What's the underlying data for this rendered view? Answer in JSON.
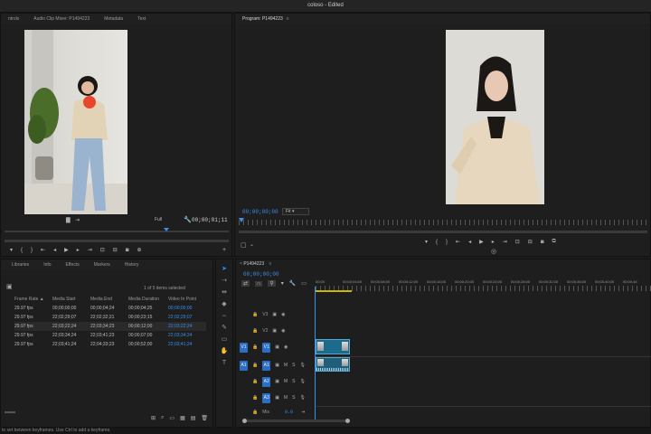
{
  "window": {
    "title": "coloso - Edited"
  },
  "source_panel": {
    "tabs": [
      "ntrols",
      "Audio Clip Mixer: P1494223",
      "Metadata",
      "Text"
    ],
    "zoom_select": "Full",
    "timecode": "00;00;01;11"
  },
  "program_panel": {
    "title": "Program: P1494223",
    "menu_glyph": "≡",
    "timecode": "00;00;00;00",
    "zoom_select": "Fit"
  },
  "project_panel": {
    "tabs": [
      "Libraries",
      "Info",
      "Effects",
      "Markers",
      "History"
    ],
    "selection_status": "1 of 5 items selected",
    "columns": [
      "Frame Rate",
      "Media Start",
      "Media End",
      "Media Duration",
      "Video In Point"
    ],
    "rows": [
      [
        "29.97 fps",
        "00;00;00;00",
        "00;00;04;24",
        "00;00;04;25",
        "00;00;00;00"
      ],
      [
        "29.97 fps",
        "22;02;29;07",
        "22;02;32;21",
        "00;00;23;15",
        "22;02;29;07"
      ],
      [
        "29.97 fps",
        "22;03;22;24",
        "22;03;34;23",
        "00;00;12;00",
        "22;03;22;24"
      ],
      [
        "29.97 fps",
        "22;03;34;24",
        "22;03;41;23",
        "00;00;07;00",
        "22;03;34;24"
      ],
      [
        "29.97 fps",
        "22;03;41;24",
        "22;04;33;23",
        "00;00;52;00",
        "22;03;41;24"
      ]
    ]
  },
  "timeline": {
    "sequence_name": "P1494223",
    "menu_glyph": "≡",
    "timecode": "00;00;00;00",
    "ruler_labels": [
      "00;00",
      "00;00;04;00",
      "00;00;08;00",
      "00;00;12;00",
      "00;00;16;00",
      "00;00;20;00",
      "00;00;24;00",
      "00;00;28;00",
      "00;00;32;00",
      "00;00;36;00",
      "00;00;40;00",
      "00;00;44"
    ],
    "tracks": {
      "video": [
        "V3",
        "V2",
        "V1"
      ],
      "audio": [
        "A1",
        "A2",
        "A3"
      ],
      "mix_label": "Mix",
      "mix_value": "0.0",
      "solo": "S",
      "mute": "M",
      "src_v1": "V1",
      "src_a1": "A1"
    }
  },
  "status_bar": {
    "text": "to set between keyframes. Use Ctrl to add a keyframe."
  },
  "colors": {
    "accent": "#2d8cff",
    "clip_video": "#1d6b8c",
    "clip_audio": "#1f5f7a"
  }
}
